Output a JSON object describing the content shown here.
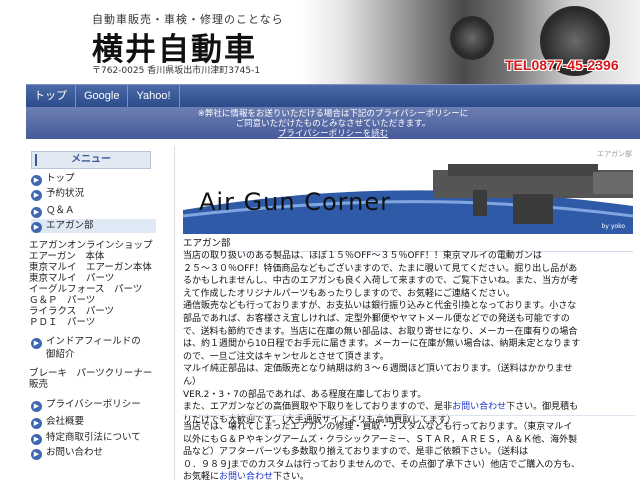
{
  "header": {
    "tagline": "自動車販売・車検・修理のことなら",
    "company_name": "横井自動車",
    "address": "〒762-0025 香川県坂出市川津町3745-1",
    "tel": "TEL0877-45-2396"
  },
  "nav": {
    "items": [
      "トップ",
      "Google",
      "Yahoo!"
    ]
  },
  "notice": {
    "line1": "※弊社に情報をお送りいただける場合は下記のプライバシーポリシーに",
    "line2": "ご同意いただけたものとみなさせていただきます。",
    "link": "プライバシーポリシーを読む"
  },
  "sidebar": {
    "menu_title": "メニュー",
    "items": [
      {
        "label": "トップ",
        "icon": "arrow-right-icon"
      },
      {
        "label": "予約状況",
        "icon": "arrow-right-icon"
      },
      {
        "label": "Ｑ＆Ａ",
        "icon": "arrow-right-icon"
      },
      {
        "label": "エアガン部",
        "icon": "arrow-right-icon"
      }
    ],
    "links": [
      "エアガンオンラインショップ",
      "エアーガン　本体",
      "東京マルイ　エアーガン本体",
      "東京マルイ　パーツ",
      "イーグルフォース　パーツ",
      "Ｇ＆Ｐ　パーツ",
      "ライラクス　パーツ",
      "ＰＤＩ　パーツ"
    ],
    "indian_field": "インドアフィールドの",
    "indian_field2": "御紹介",
    "brake_line1": "ブレーキ　パーツクリーナー",
    "brake_line2": "販売",
    "bottom_items": [
      "プライバシーポリシー",
      "会社概要",
      "特定商取引法について",
      "お問い合わせ"
    ]
  },
  "main": {
    "crumb": "エアガン部",
    "banner_title": "Air Gun Corner",
    "banner_by": "by yoko",
    "subhead": "エアガン部",
    "para1_lines": [
      "当店の取り扱いのある製品は、ほぼ１５％OFF～３５％OFF！！東京マルイの電動ガンは",
      "２５～３０％OFF！特価商品などもございますので、たまに覗いて見てください。掘り出し品があ",
      "るかもしれませんし、中古のエアガンも良く入荷して来ますので、ご覧下さいね。また、当方が考",
      "えて作成したオリジナルパーツもあったりしますので、お気軽にご連絡ください。",
      "通信販売なども行っておりますが、お支払いは銀行振り込みと代金引換となっております。小さな",
      "部品であれば、お客様さえ宜しければ、定型外郵便やヤマトメール便などでの発送も可能ですの",
      "で、送料も節約できます。当店に在庫の無い部品は、お取り寄せになり、メーカー在庫有りの場合",
      "は、約１週間から10日程でお手元に届きます。メーカーに在庫が無い場合は、納期未定となります",
      "ので、一旦ご注文はキャンセルとさせて頂きます。",
      "マルイ純正部品は、定価販売となり納期は約３～６週間ほど頂いております。（送料はかかりませ",
      "ん）",
      "VER.2・3・7の部品であれば、ある程度在庫しております。",
      "また、エアガンなどの高価買取や下取りをしておりますので、是非|お問い合わせ|下さい。御見積も",
      "りだけでも大歓迎です。（大手通販サイトよりも高価買取してます）"
    ],
    "para2_lines": [
      "当店では、壊れてしまったエアガンの修理・買取・カスタムなども行っております。（東京マルイ",
      "以外にもＧ＆Ｐやキングアームズ・クラシックアーミー、ＳＴＡＲ，ＡＲＥＳ，Ａ＆Ｋ他、海外製",
      "品など）アフターパーツも多数取り揃えておりますので、是非ご依頼下さい。（送料は",
      "０．９８９Jまでのカスタムは行っておりませんので、その点御了承下さい）他店でご購入の方も、",
      "お気軽に|お問い合わせ|下さい。"
    ]
  },
  "colors": {
    "nav_bg": "#3a5a95",
    "tel_red": "#d71818",
    "link_blue": "#1a33cc"
  }
}
